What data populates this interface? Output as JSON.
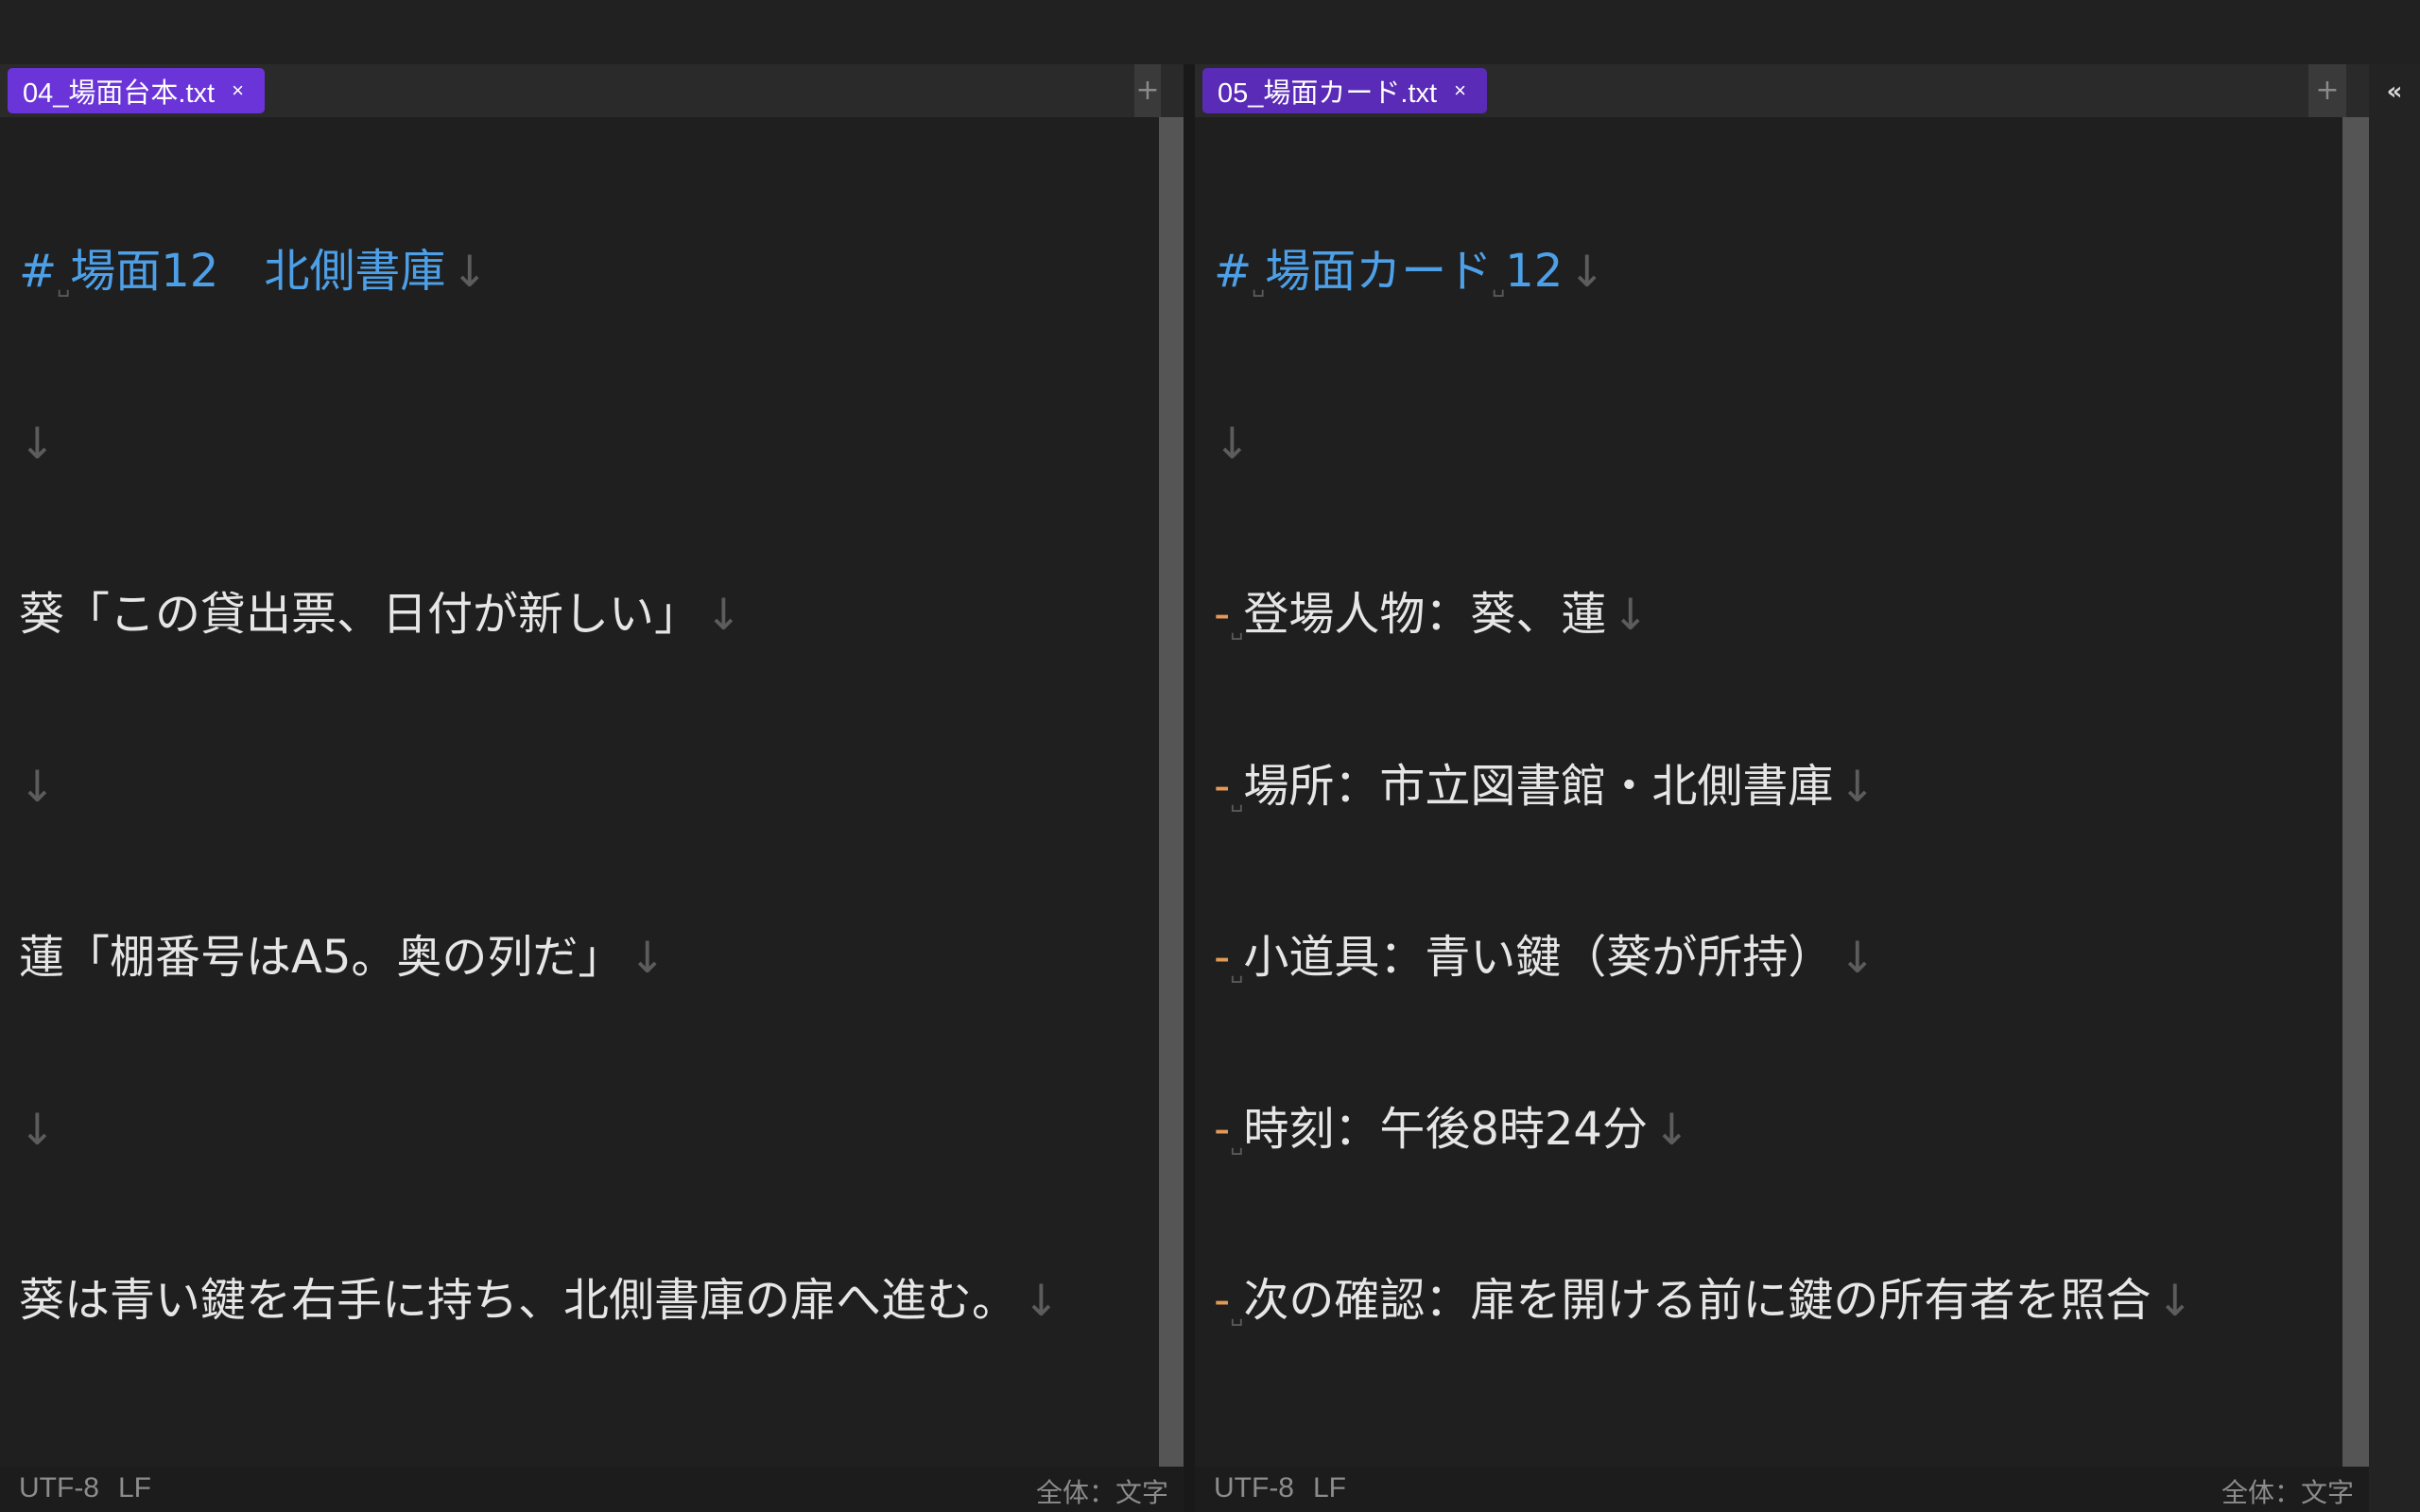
{
  "left_pane": {
    "tab_title": "04_場面台本.txt",
    "close_glyph": "×",
    "add_glyph": "+",
    "lines": [
      {
        "kind": "heading",
        "hash": "#",
        "text_a": "場面12",
        "text_b": "北側書庫"
      },
      {
        "kind": "blank"
      },
      {
        "kind": "text",
        "text": "葵「この貸出票、日付が新しい」"
      },
      {
        "kind": "blank"
      },
      {
        "kind": "text",
        "text": "蓮「棚番号はA5。奥の列だ」"
      },
      {
        "kind": "blank"
      },
      {
        "kind": "text",
        "text": "葵は青い鍵を右手に持ち、北側書庫の扉へ進む。"
      }
    ],
    "status": {
      "encoding": "UTF-8",
      "line_ending": "LF",
      "count": "全体：文字"
    }
  },
  "right_pane": {
    "tab_title": "05_場面カード.txt",
    "close_glyph": "×",
    "add_glyph": "+",
    "lines": [
      {
        "kind": "heading2",
        "hash": "#",
        "text_a": "場面カード",
        "text_b": "12"
      },
      {
        "kind": "blank"
      },
      {
        "kind": "bullet",
        "dash": "-",
        "text": "登場人物：葵、蓮"
      },
      {
        "kind": "bullet",
        "dash": "-",
        "text": "場所：市立図書館・北側書庫"
      },
      {
        "kind": "bullet",
        "dash": "-",
        "text": "小道具：青い鍵（葵が所持）"
      },
      {
        "kind": "bullet",
        "dash": "-",
        "text": "時刻：午後8時24分"
      },
      {
        "kind": "bullet",
        "dash": "-",
        "text": "次の確認：扉を開ける前に鍵の所有者を照合"
      }
    ],
    "status": {
      "encoding": "UTF-8",
      "line_ending": "LF",
      "count": "全体：文字"
    }
  },
  "symbols": {
    "newline": "↓",
    "space_mark": "␣",
    "collapse": "«"
  },
  "colors": {
    "tab_active": "#6a34d8",
    "heading": "#4da0e8",
    "bullet_dash": "#e39a56",
    "background": "#1f1f1f"
  }
}
